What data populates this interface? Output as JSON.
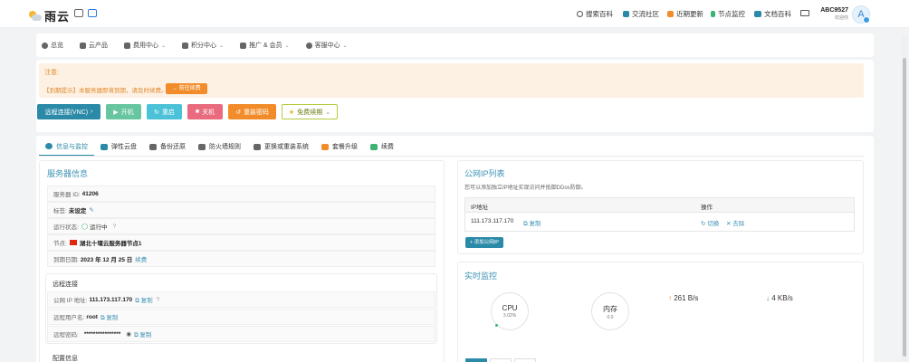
{
  "brand": {
    "name": "雨云"
  },
  "topnav": [
    {
      "label": "搜索百科",
      "icon": "search-icon",
      "color": "#555555"
    },
    {
      "label": "交流社区",
      "icon": "chat-icon",
      "color": "#2b8aa8"
    },
    {
      "label": "近期更新",
      "icon": "update-icon",
      "color": "#f28c2b"
    },
    {
      "label": "节点监控",
      "icon": "node-icon",
      "color": "#3cb371"
    },
    {
      "label": "文档百科",
      "icon": "book-icon",
      "color": "#2b8aa8"
    }
  ],
  "user": {
    "name": "ABC9527",
    "subtitle": "欢迎你",
    "avatar_letter": "A"
  },
  "subnav": [
    {
      "label": "总览",
      "chevron": ""
    },
    {
      "label": "云产品",
      "chevron": ""
    },
    {
      "label": "费用中心",
      "chevron": "⌄"
    },
    {
      "label": "积分中心",
      "chevron": "⌄"
    },
    {
      "label": "推广 & 会员",
      "chevron": "⌄"
    },
    {
      "label": "客服中心",
      "chevron": "⌄"
    }
  ],
  "notice": {
    "title": "注意:",
    "message": "【到期提示】本服务器即将到期，请及时续费。",
    "button": "→ 前往续费"
  },
  "actions": [
    {
      "label": "远程连接(VNC)",
      "glyph": "›",
      "color": "#2b8aa8"
    },
    {
      "label": "开机",
      "glyph": "▶",
      "color": "#67c5a0"
    },
    {
      "label": "重启",
      "glyph": "↻",
      "color": "#4cc2d8"
    },
    {
      "label": "关机",
      "glyph": "■",
      "color": "#ea6a7e"
    },
    {
      "label": "重装密码",
      "glyph": "↺",
      "color": "#f28c2b"
    },
    {
      "label": "免费续期",
      "glyph": "★",
      "color": "#b5c93b"
    }
  ],
  "tabs": [
    {
      "label": "信息与监控"
    },
    {
      "label": "弹性云盘"
    },
    {
      "label": "备份还原"
    },
    {
      "label": "防火墙规则"
    },
    {
      "label": "更换或重装系统"
    },
    {
      "label": "套餐升级"
    },
    {
      "label": "续费"
    }
  ],
  "server_info": {
    "title": "服务器信息",
    "rows": [
      {
        "label": "服务器 ID:",
        "value": "41206",
        "extra": ""
      },
      {
        "label": "标签:",
        "value": "未设定",
        "extra": "✎"
      },
      {
        "label": "运行状态:",
        "value": "运行中",
        "extra": "?"
      },
      {
        "label": "节点:",
        "value": "湖北十堰云服务器节点1",
        "extra": ""
      },
      {
        "label": "到期日期:",
        "value": "2023 年 12 月 25 日",
        "extra": "续费"
      }
    ]
  },
  "remote": {
    "title": "远程连接",
    "rows": [
      {
        "label": "公网 IP 地址:",
        "value": "111.173.117.170",
        "extra": "复制"
      },
      {
        "label": "远程用户名:",
        "value": "root",
        "extra": "复制"
      },
      {
        "label": "远程密码:",
        "value": "****************",
        "extra": "复制"
      }
    ]
  },
  "config": {
    "title": "配置信息"
  },
  "public_ip": {
    "title": "公网IP列表",
    "desc": "您可以添加独立IP地址实现访问并抵御DDos防御。",
    "head_ip": "IP地址",
    "head_op": "操作",
    "ip": "111.173.117.170",
    "copy": "复制",
    "switch": "切换",
    "remove": "去除",
    "add_button": "+ 添加公网IP"
  },
  "monitor": {
    "title": "实时监控",
    "cpu_label": "CPU",
    "cpu_value": "3.02%",
    "mem_label": "内存",
    "mem_value": "0.0",
    "up": "261 B/s",
    "down": "4 KB/s"
  }
}
